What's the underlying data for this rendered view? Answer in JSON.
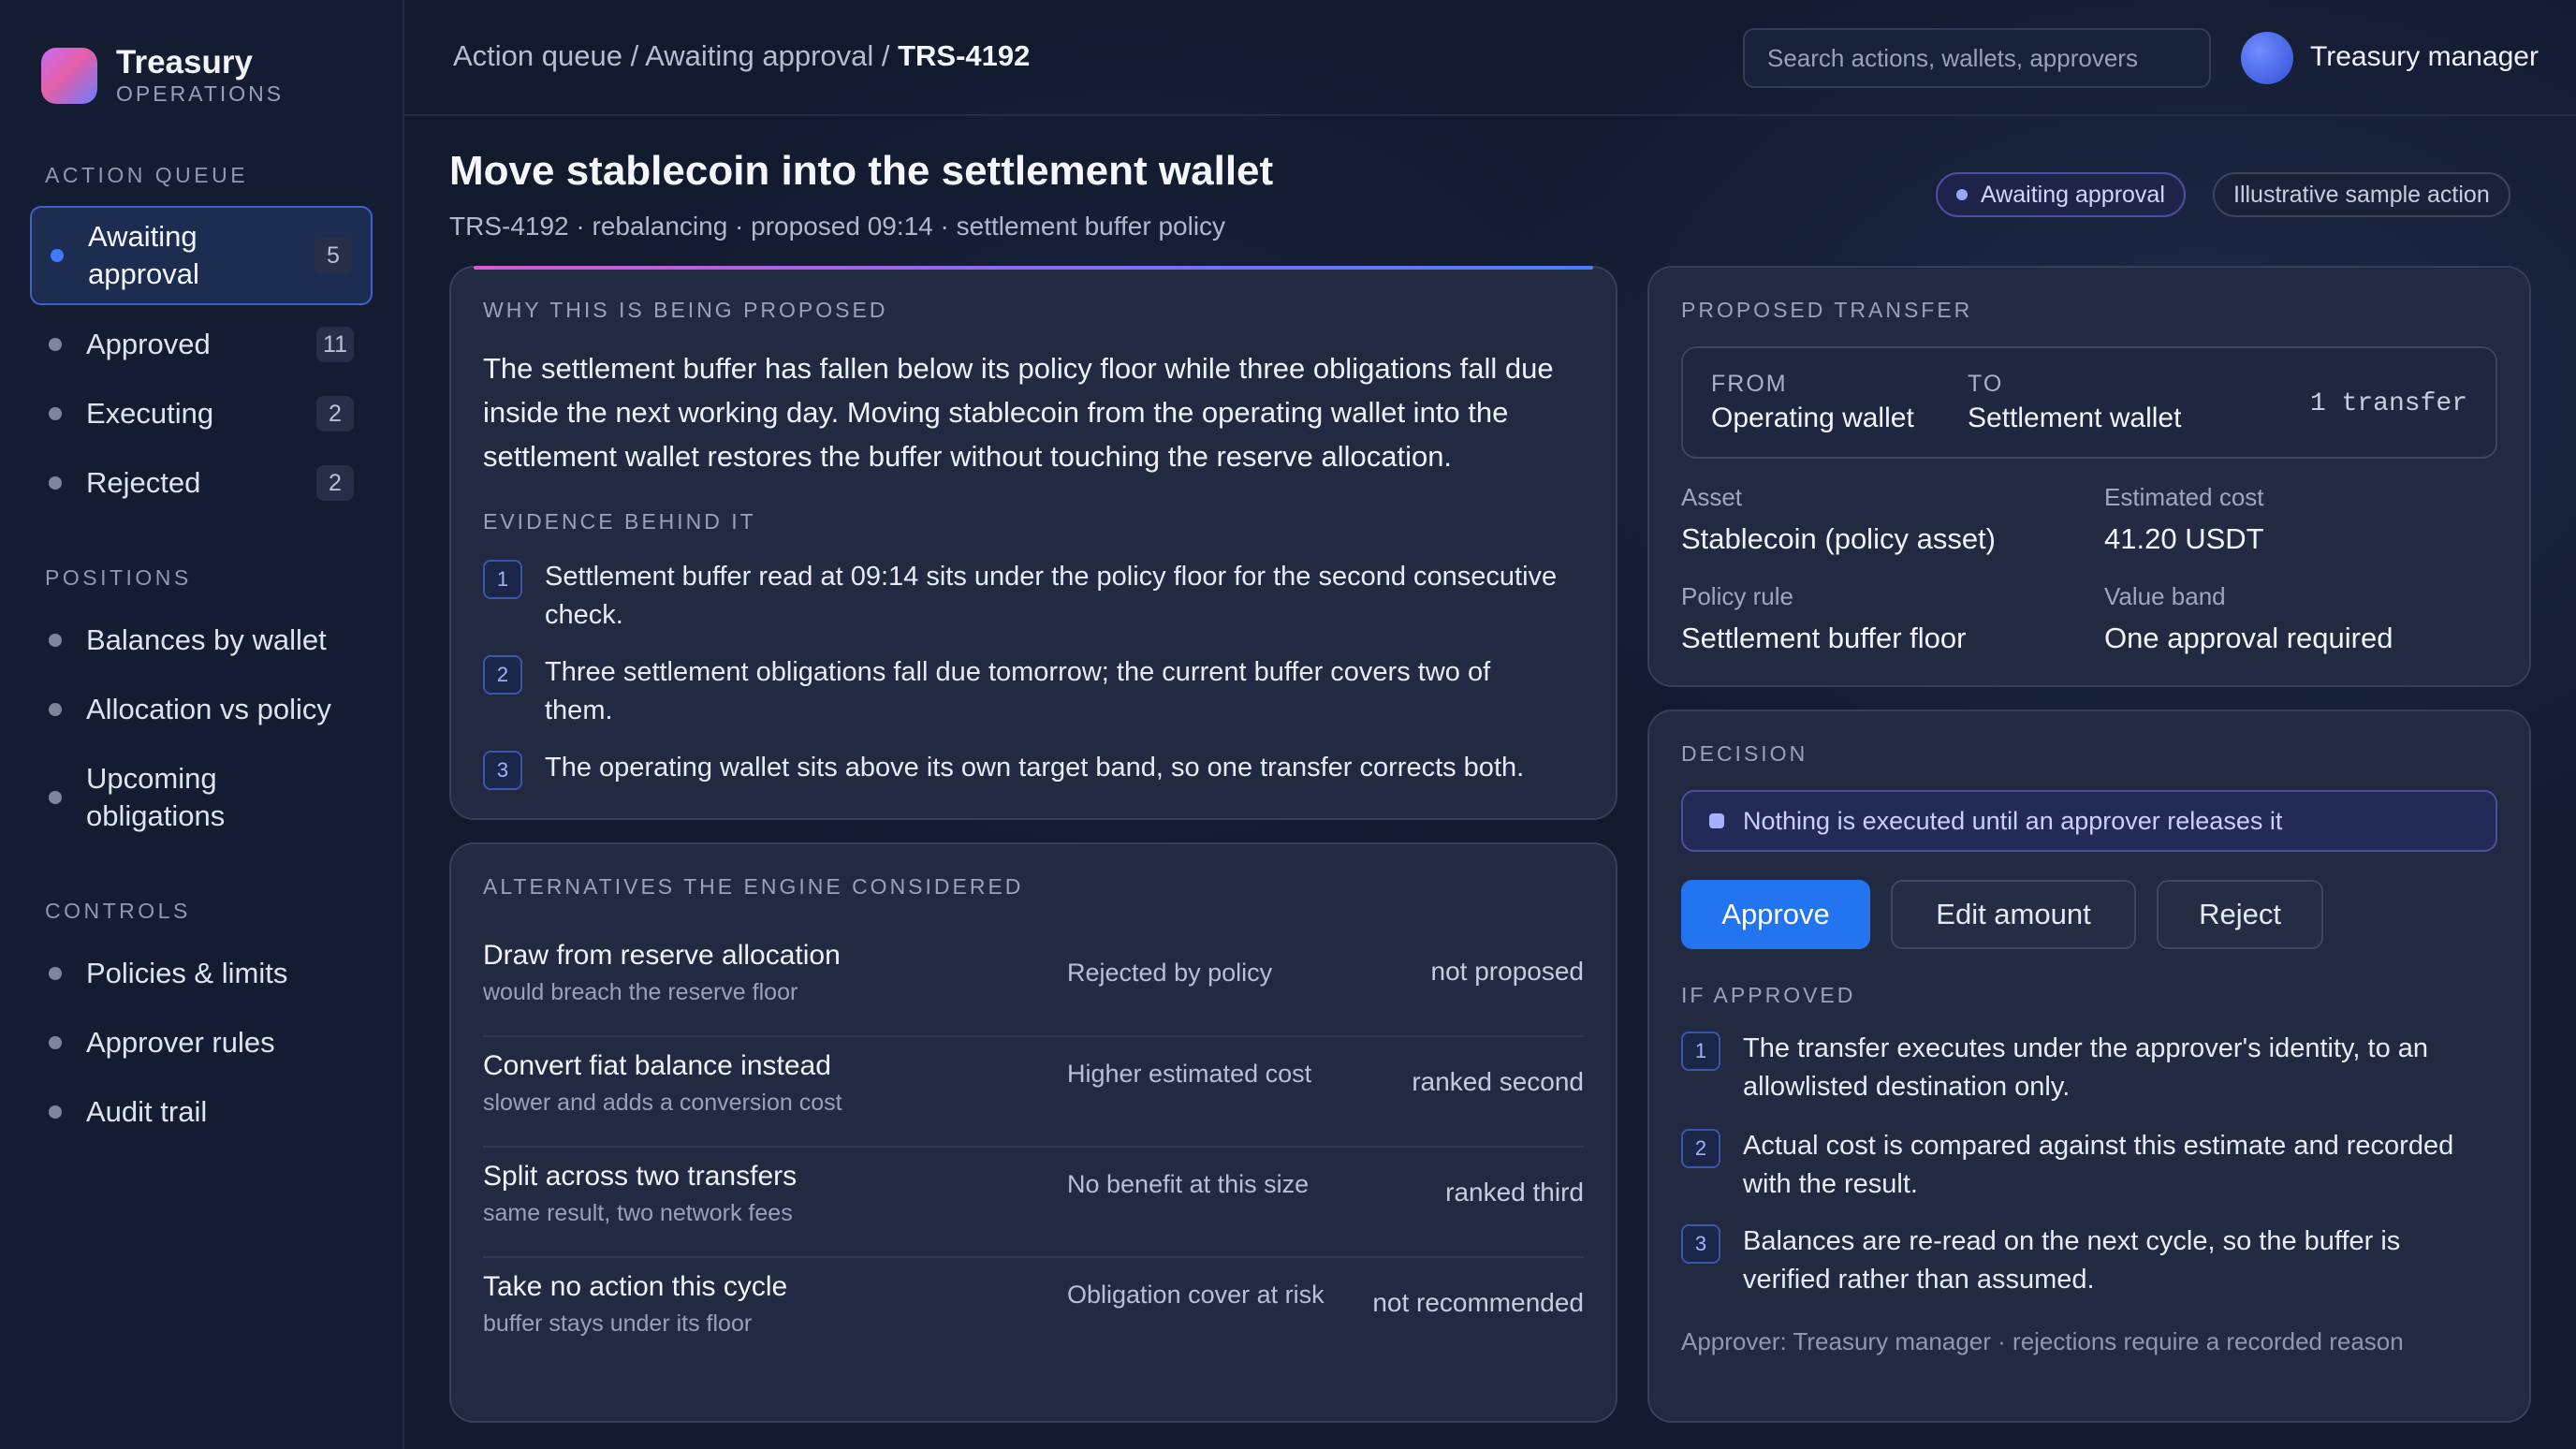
{
  "brand": {
    "name": "Treasury",
    "subtitle": "OPERATIONS"
  },
  "sidebar": {
    "sections": [
      {
        "label": "ACTION QUEUE",
        "items": [
          {
            "label": "Awaiting approval",
            "count": "5",
            "active": true
          },
          {
            "label": "Approved",
            "count": "11"
          },
          {
            "label": "Executing",
            "count": "2"
          },
          {
            "label": "Rejected",
            "count": "2"
          }
        ]
      },
      {
        "label": "POSITIONS",
        "items": [
          {
            "label": "Balances by wallet"
          },
          {
            "label": "Allocation vs policy"
          },
          {
            "label": "Upcoming obligations"
          }
        ]
      },
      {
        "label": "CONTROLS",
        "items": [
          {
            "label": "Policies & limits"
          },
          {
            "label": "Approver rules"
          },
          {
            "label": "Audit trail"
          }
        ]
      }
    ]
  },
  "header": {
    "breadcrumb": [
      "Action queue",
      "Awaiting approval",
      "TRS-4192"
    ],
    "separator": " / ",
    "search_placeholder": "Search actions, wallets, approvers",
    "user_name": "Treasury manager"
  },
  "action": {
    "title": "Move stablecoin into the settlement wallet",
    "meta": "TRS-4192 · rebalancing · proposed 09:14 · settlement buffer policy",
    "status_badge": "Awaiting approval",
    "sample_badge": "Illustrative sample action"
  },
  "why": {
    "label": "WHY THIS IS BEING PROPOSED",
    "text": "The settlement buffer has fallen below its policy floor while three obligations fall due inside the next working day. Moving stablecoin from the operating wallet into the settlement wallet restores the buffer without touching the reserve allocation.",
    "evidence_label": "EVIDENCE BEHIND IT",
    "evidence": [
      {
        "num": "1",
        "text": "Settlement buffer read at 09:14 sits under the policy floor for the second consecutive check."
      },
      {
        "num": "2",
        "text": "Three settlement obligations fall due tomorrow; the current buffer covers two of them."
      },
      {
        "num": "3",
        "text": "The operating wallet sits above its own target band, so one transfer corrects both."
      }
    ]
  },
  "alternatives": {
    "label": "ALTERNATIVES THE ENGINE CONSIDERED",
    "rows": [
      {
        "name": "Draw from reserve allocation",
        "sub": "would breach the reserve floor",
        "reason": "Rejected by policy",
        "status": "not proposed"
      },
      {
        "name": "Convert fiat balance instead",
        "sub": "slower and adds a conversion cost",
        "reason": "Higher estimated cost",
        "status": "ranked second"
      },
      {
        "name": "Split across two transfers",
        "sub": "same result, two network fees",
        "reason": "No benefit at this size",
        "status": "ranked third"
      },
      {
        "name": "Take no action this cycle",
        "sub": "buffer stays under its floor",
        "reason": "Obligation cover at risk",
        "status": "not recommended"
      }
    ]
  },
  "transfer": {
    "label": "PROPOSED TRANSFER",
    "from_label": "FROM",
    "from_value": "Operating wallet",
    "to_label": "TO",
    "to_value": "Settlement wallet",
    "count": "1 transfer",
    "fields": [
      {
        "label": "Asset",
        "value": "Stablecoin (policy asset)"
      },
      {
        "label": "Estimated cost",
        "value": "41.20 USDT"
      },
      {
        "label": "Policy rule",
        "value": "Settlement buffer floor"
      },
      {
        "label": "Value band",
        "value": "One approval required"
      }
    ]
  },
  "decision": {
    "label": "DECISION",
    "notice": "Nothing is executed until an approver releases it",
    "approve_label": "Approve",
    "edit_label": "Edit amount",
    "reject_label": "Reject",
    "if_approved_label": "IF APPROVED",
    "steps": [
      {
        "num": "1",
        "text": "The transfer executes under the approver's identity, to an allowlisted destination only."
      },
      {
        "num": "2",
        "text": "Actual cost is compared against this estimate and recorded with the result."
      },
      {
        "num": "3",
        "text": "Balances are re-read on the next cycle, so the buffer is verified rather than assumed."
      }
    ],
    "footnote": "Approver: Treasury manager · rejections require a recorded reason"
  },
  "colors": {
    "accent": "#2374f0",
    "active_nav": "#3d7bff",
    "status_badge": "#9aa5ff"
  }
}
